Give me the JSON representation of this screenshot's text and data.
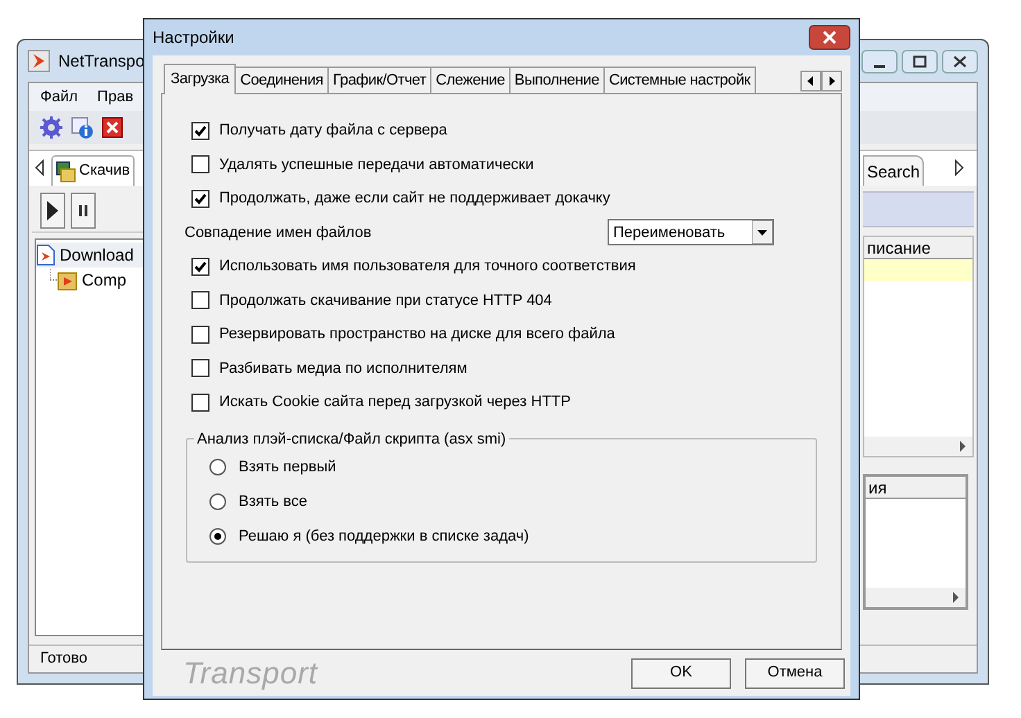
{
  "main_window": {
    "title": "NetTranspo",
    "menu": [
      "Файл",
      "Прав"
    ],
    "tabs": [
      {
        "label": "Скачив"
      },
      {
        "label": "Search"
      }
    ],
    "tree": [
      {
        "label": "Download",
        "children": [
          {
            "label": "Comp"
          }
        ]
      }
    ],
    "list_header": "писание",
    "lower_header": "ия",
    "status": "Готово"
  },
  "dialog": {
    "title": "Настройки",
    "tabs": [
      {
        "label": "Загрузка",
        "selected": true
      },
      {
        "label": "Соединения",
        "selected": false
      },
      {
        "label": "График/Отчет",
        "selected": false
      },
      {
        "label": "Слежение",
        "selected": false
      },
      {
        "label": "Выполнение",
        "selected": false
      },
      {
        "label": "Системные настройк",
        "selected": false
      }
    ],
    "options": [
      {
        "kind": "checkbox",
        "label": "Получать дату файла с сервера",
        "checked": true
      },
      {
        "kind": "checkbox",
        "label": "Удалять успешные передачи автоматически",
        "checked": false
      },
      {
        "kind": "checkbox",
        "label": "Продолжать, даже если сайт не поддерживает докачку",
        "checked": true
      },
      {
        "kind": "select",
        "label": "Совпадение имен файлов",
        "value": "Переименовать"
      },
      {
        "kind": "checkbox",
        "label": "Использовать имя пользователя для точного соответствия",
        "checked": true
      },
      {
        "kind": "checkbox",
        "label": "Продолжать скачивание при статусе HTTP 404",
        "checked": false
      },
      {
        "kind": "checkbox",
        "label": "Резервировать пространство на диске для всего файла",
        "checked": false
      },
      {
        "kind": "checkbox",
        "label": "Разбивать медиа по исполнителям",
        "checked": false
      },
      {
        "kind": "checkbox",
        "label": "Искать Cookie сайта перед загрузкой через HTTP",
        "checked": false
      }
    ],
    "group": {
      "title": "Анализ плэй-списка/Файл скрипта (asx smi)",
      "radios": [
        {
          "label": "Взять первый",
          "selected": false
        },
        {
          "label": "Взять все",
          "selected": false
        },
        {
          "label": "Решаю я (без поддержки в списке задач)",
          "selected": true
        }
      ]
    },
    "logo": "Transport",
    "buttons": [
      "OK",
      "Отмена"
    ]
  }
}
